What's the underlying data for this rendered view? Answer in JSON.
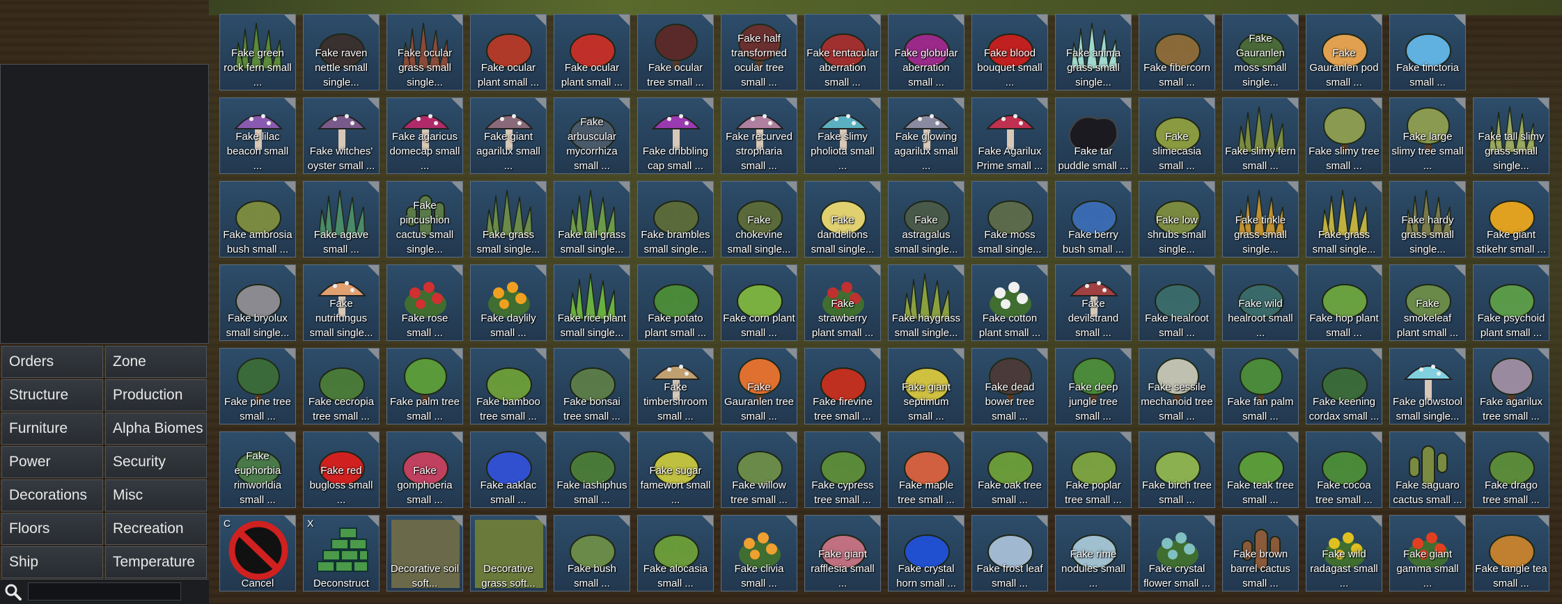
{
  "categories": [
    {
      "label": "Orders",
      "key": "orders"
    },
    {
      "label": "Zone",
      "key": "zone"
    },
    {
      "label": "Structure",
      "key": "structure"
    },
    {
      "label": "Production",
      "key": "production"
    },
    {
      "label": "Furniture",
      "key": "furniture"
    },
    {
      "label": "Alpha Biomes",
      "key": "alpha-biomes"
    },
    {
      "label": "Power",
      "key": "power"
    },
    {
      "label": "Security",
      "key": "security"
    },
    {
      "label": "Decorations",
      "key": "decorations"
    },
    {
      "label": "Misc",
      "key": "misc"
    },
    {
      "label": "Floors",
      "key": "floors"
    },
    {
      "label": "Recreation",
      "key": "recreation"
    },
    {
      "label": "Ship",
      "key": "ship"
    },
    {
      "label": "Temperature",
      "key": "temperature"
    }
  ],
  "search": {
    "value": "",
    "placeholder": ""
  },
  "rows": [
    [
      {
        "label": "Fake green rock fern small ...",
        "icon": "green-fern-icon",
        "color": "#5a8a3a"
      },
      {
        "label": "Fake raven nettle small single...",
        "icon": "raven-nettle-icon",
        "color": "#3a3030"
      },
      {
        "label": "Fake ocular grass small single...",
        "icon": "ocular-grass-icon",
        "color": "#8a4a3a"
      },
      {
        "label": "Fake ocular plant small ...",
        "icon": "ocular-plant-icon",
        "color": "#b03a2a"
      },
      {
        "label": "Fake ocular plant small ...",
        "icon": "ocular-plant-icon",
        "color": "#c0302a"
      },
      {
        "label": "Fake ocular tree small ...",
        "icon": "ocular-tree-icon",
        "color": "#5a2a2a"
      },
      {
        "label": "Fake half transformed ocular tree small ...",
        "icon": "half-ocular-tree-icon",
        "color": "#6a3030"
      },
      {
        "label": "Fake tentacular aberration small ...",
        "icon": "tentacle-icon",
        "color": "#a03030"
      },
      {
        "label": "Fake globular aberration small ...",
        "icon": "globular-icon",
        "color": "#9a2a8a"
      },
      {
        "label": "Fake blood bouquet small ...",
        "icon": "blood-bouquet-icon",
        "color": "#c02020"
      },
      {
        "label": "Fake anima grass small single...",
        "icon": "anima-grass-icon",
        "color": "#a0d8d0"
      },
      {
        "label": "Fake fibercorn small ...",
        "icon": "fibercorn-icon",
        "color": "#8a6a3a"
      },
      {
        "label": "Fake Gauranlen moss small single...",
        "icon": "moss-icon",
        "color": "#4a6a3a"
      },
      {
        "label": "Fake Gauranlen pod small ...",
        "icon": "pod-icon",
        "color": "#e0a050"
      },
      {
        "label": "Fake tinctoria small ...",
        "icon": "tinctoria-icon",
        "color": "#60b0e0"
      }
    ],
    [
      {
        "label": "Fake lilac beacon small ...",
        "icon": "lilac-beacon-icon",
        "color": "#8a5ab0"
      },
      {
        "label": "Fake witches' oyster small ...",
        "icon": "mushroom-icon",
        "color": "#7a5a8a"
      },
      {
        "label": "Fake agaricus domecap small ...",
        "icon": "domecap-icon",
        "color": "#b02a6a"
      },
      {
        "label": "Fake giant agarilux small ...",
        "icon": "agarilux-icon",
        "color": "#8a6a7a"
      },
      {
        "label": "Fake arbuscular mycorrhiza small ...",
        "icon": "mycorrhiza-icon",
        "color": "#4a5a6a"
      },
      {
        "label": "Fake dribbling cap small ...",
        "icon": "dribbling-cap-icon",
        "color": "#9a3ab0"
      },
      {
        "label": "Fake recurved stropharia small ...",
        "icon": "stropharia-icon",
        "color": "#b080a0"
      },
      {
        "label": "Fake slimy pholiota small ...",
        "icon": "pholiota-icon",
        "color": "#5ab0c0"
      },
      {
        "label": "Fake glowing agarilux small ...",
        "icon": "glowing-agarilux-icon",
        "color": "#8a8aa0"
      },
      {
        "label": "Fake Agarilux Prime small ...",
        "icon": "agarilux-prime-icon",
        "color": "#c03050"
      },
      {
        "label": "Fake tar puddle small ...",
        "icon": "tar-puddle-icon",
        "color": "#1a1a20"
      },
      {
        "label": "Fake slimecasia small ...",
        "icon": "slimecasia-icon",
        "color": "#8a9a40"
      },
      {
        "label": "Fake slimy fern small ...",
        "icon": "slimy-fern-icon",
        "color": "#7a8a40"
      },
      {
        "label": "Fake slimy tree small ...",
        "icon": "slimy-tree-icon",
        "color": "#8a9a50"
      },
      {
        "label": "Fake large slimy tree small ...",
        "icon": "large-slimy-tree-icon",
        "color": "#8a9a50"
      },
      {
        "label": "Fake tall slimy grass small single...",
        "icon": "slimy-grass-icon",
        "color": "#9aa860"
      }
    ],
    [
      {
        "label": "Fake ambrosia bush small ...",
        "icon": "ambrosia-icon",
        "color": "#7a8a40"
      },
      {
        "label": "Fake agave small ...",
        "icon": "agave-icon",
        "color": "#4a8a6a"
      },
      {
        "label": "Fake pincushion cactus small single...",
        "icon": "cactus-icon",
        "color": "#5a7a4a"
      },
      {
        "label": "Fake grass small single...",
        "icon": "grass-icon",
        "color": "#6a8a4a"
      },
      {
        "label": "Fake tall grass small single...",
        "icon": "tall-grass-icon",
        "color": "#6a9a4a"
      },
      {
        "label": "Fake brambles small single...",
        "icon": "brambles-icon",
        "color": "#5a6a3a"
      },
      {
        "label": "Fake chokevine small single...",
        "icon": "chokevine-icon",
        "color": "#5a6a3a"
      },
      {
        "label": "Fake dandelions small single...",
        "icon": "dandelion-icon",
        "color": "#e0d070"
      },
      {
        "label": "Fake astragalus small single...",
        "icon": "astragalus-icon",
        "color": "#4a5a4a"
      },
      {
        "label": "Fake moss small single...",
        "icon": "moss-icon",
        "color": "#5a6a4a"
      },
      {
        "label": "Fake berry bush small ...",
        "icon": "berry-bush-icon",
        "color": "#3a6ab0"
      },
      {
        "label": "Fake low shrubs small single...",
        "icon": "shrubs-icon",
        "color": "#7a8a40"
      },
      {
        "label": "Fake tinkle grass small single...",
        "icon": "tinkle-grass-icon",
        "color": "#c09030"
      },
      {
        "label": "Fake grass small single...",
        "icon": "grass-icon",
        "color": "#c0b040"
      },
      {
        "label": "Fake hardy grass small single...",
        "icon": "hardy-grass-icon",
        "color": "#7a7a4a"
      },
      {
        "label": "Fake giant stikehr small ...",
        "icon": "stikehr-icon",
        "color": "#e0a020"
      }
    ],
    [
      {
        "label": "Fake bryolux small single...",
        "icon": "bryolux-icon",
        "color": "#8a8a90"
      },
      {
        "label": "Fake nutrifungus small single...",
        "icon": "nutrifungus-icon",
        "color": "#e0a070"
      },
      {
        "label": "Fake rose small ...",
        "icon": "rose-icon",
        "color": "#d03030"
      },
      {
        "label": "Fake daylily small ...",
        "icon": "daylily-icon",
        "color": "#f0a020"
      },
      {
        "label": "Fake rice plant small single...",
        "icon": "rice-icon",
        "color": "#6ab040"
      },
      {
        "label": "Fake potato plant small ...",
        "icon": "potato-icon",
        "color": "#4a8a3a"
      },
      {
        "label": "Fake corn plant small ...",
        "icon": "corn-icon",
        "color": "#7ab040"
      },
      {
        "label": "Fake strawberry plant small ...",
        "icon": "strawberry-icon",
        "color": "#c03030"
      },
      {
        "label": "Fake haygrass small single...",
        "icon": "haygrass-icon",
        "color": "#8aa040"
      },
      {
        "label": "Fake cotton plant small ...",
        "icon": "cotton-icon",
        "color": "#f0f0f0"
      },
      {
        "label": "Fake devilstrand small ...",
        "icon": "devilstrand-icon",
        "color": "#a04040"
      },
      {
        "label": "Fake healroot small ...",
        "icon": "healroot-icon",
        "color": "#3a6a6a"
      },
      {
        "label": "Fake wild healroot small ...",
        "icon": "wild-healroot-icon",
        "color": "#3a6a6a"
      },
      {
        "label": "Fake hop plant small ...",
        "icon": "hop-icon",
        "color": "#6aa040"
      },
      {
        "label": "Fake smokeleaf plant small ...",
        "icon": "smokeleaf-icon",
        "color": "#6a8a4a"
      },
      {
        "label": "Fake psychoid plant small ...",
        "icon": "psychoid-icon",
        "color": "#5a9a4a"
      }
    ],
    [
      {
        "label": "Fake pine tree small ...",
        "icon": "pine-tree-icon",
        "color": "#3a6a3a"
      },
      {
        "label": "Fake cecropia tree small ...",
        "icon": "cecropia-icon",
        "color": "#4a7a3a"
      },
      {
        "label": "Fake palm tree small ...",
        "icon": "palm-tree-icon",
        "color": "#5a9a3a"
      },
      {
        "label": "Fake bamboo tree small ...",
        "icon": "bamboo-icon",
        "color": "#6a9a3a"
      },
      {
        "label": "Fake bonsai tree small ...",
        "icon": "bonsai-icon",
        "color": "#5a7a4a"
      },
      {
        "label": "Fake timbershroom small ...",
        "icon": "timbershroom-icon",
        "color": "#c0a070"
      },
      {
        "label": "Fake Gauranlen tree small ...",
        "icon": "gauranlen-tree-icon",
        "color": "#e07030"
      },
      {
        "label": "Fake firevine tree small ...",
        "icon": "firevine-icon",
        "color": "#c03020"
      },
      {
        "label": "Fake giant septimum small ...",
        "icon": "septimum-icon",
        "color": "#d0c040"
      },
      {
        "label": "Fake dead bower tree small ...",
        "icon": "dead-tree-icon",
        "color": "#4a3a3a"
      },
      {
        "label": "Fake deep jungle tree small ...",
        "icon": "jungle-tree-icon",
        "color": "#4a8a3a"
      },
      {
        "label": "Fake sessile mechanoid tree small ...",
        "icon": "mechanoid-tree-icon",
        "color": "#c0c0b0"
      },
      {
        "label": "Fake fan palm small ...",
        "icon": "fan-palm-icon",
        "color": "#4a8a3a"
      },
      {
        "label": "Fake keening cordax small ...",
        "icon": "cordax-icon",
        "color": "#3a6a3a"
      },
      {
        "label": "Fake glowstool small single...",
        "icon": "glowstool-icon",
        "color": "#80d0e0"
      },
      {
        "label": "Fake agarilux tree small ...",
        "icon": "agarilux-tree-icon",
        "color": "#9a8aa0"
      }
    ],
    [
      {
        "label": "Fake euphorbia rimworldia small ...",
        "icon": "euphorbia-icon",
        "color": "#4a7a4a"
      },
      {
        "label": "Fake red bugloss small ...",
        "icon": "bugloss-icon",
        "color": "#d02020"
      },
      {
        "label": "Fake gomphoeria small ...",
        "icon": "gomphoeria-icon",
        "color": "#c04060"
      },
      {
        "label": "Fake aaklac small ...",
        "icon": "aaklac-icon",
        "color": "#3050d0"
      },
      {
        "label": "Fake iashiphus small ...",
        "icon": "iashiphus-icon",
        "color": "#4a7a3a"
      },
      {
        "label": "Fake sugar famewort small ...",
        "icon": "famewort-icon",
        "color": "#c0c040"
      },
      {
        "label": "Fake willow tree small ...",
        "icon": "willow-icon",
        "color": "#6a8a4a"
      },
      {
        "label": "Fake cypress tree small ...",
        "icon": "cypress-icon",
        "color": "#5a8a3a"
      },
      {
        "label": "Fake maple tree small ...",
        "icon": "maple-icon",
        "color": "#d06040"
      },
      {
        "label": "Fake oak tree small ...",
        "icon": "oak-icon",
        "color": "#6a9a3a"
      },
      {
        "label": "Fake poplar tree small ...",
        "icon": "poplar-icon",
        "color": "#7aa040"
      },
      {
        "label": "Fake birch tree small ...",
        "icon": "birch-icon",
        "color": "#8ab050"
      },
      {
        "label": "Fake teak tree small ...",
        "icon": "teak-icon",
        "color": "#5a9a3a"
      },
      {
        "label": "Fake cocoa tree small ...",
        "icon": "cocoa-icon",
        "color": "#4a8a3a"
      },
      {
        "label": "Fake saguaro cactus small ...",
        "icon": "saguaro-icon",
        "color": "#7a8a40"
      },
      {
        "label": "Fake drago tree small ...",
        "icon": "drago-icon",
        "color": "#5a8a3a"
      }
    ],
    [
      {
        "label": "Cancel",
        "icon": "cancel-icon",
        "color": "#d02020",
        "hotkey": "C"
      },
      {
        "label": "Deconstruct",
        "icon": "deconstruct-icon",
        "color": "#4a9a4a",
        "hotkey": "X"
      },
      {
        "label": "Decorative soil soft...",
        "icon": "soil-icon",
        "color": "#6a6a4a"
      },
      {
        "label": "Decorative grass soft...",
        "icon": "grass-floor-icon",
        "color": "#6a7a3a"
      },
      {
        "label": "Fake bush small ...",
        "icon": "bush-icon",
        "color": "#6a8a4a"
      },
      {
        "label": "Fake alocasia small ...",
        "icon": "alocasia-icon",
        "color": "#6a9a3a"
      },
      {
        "label": "Fake clivia small ...",
        "icon": "clivia-icon",
        "color": "#f0a030"
      },
      {
        "label": "Fake giant rafflesia small ...",
        "icon": "rafflesia-icon",
        "color": "#c07080"
      },
      {
        "label": "Fake crystal horn small ...",
        "icon": "crystal-horn-icon",
        "color": "#2050d0"
      },
      {
        "label": "Fake frost leaf small ...",
        "icon": "frost-leaf-icon",
        "color": "#a0b8d0"
      },
      {
        "label": "Fake rime nodules small ...",
        "icon": "rime-nodules-icon",
        "color": "#a0c0d0"
      },
      {
        "label": "Fake crystal flower small ...",
        "icon": "crystal-flower-icon",
        "color": "#80c0c0"
      },
      {
        "label": "Fake brown barrel cactus small ...",
        "icon": "barrel-cactus-icon",
        "color": "#8a5a3a"
      },
      {
        "label": "Fake wild radagast small ...",
        "icon": "radagast-icon",
        "color": "#e0c020"
      },
      {
        "label": "Fake giant gamma small ...",
        "icon": "gamma-icon",
        "color": "#e04020"
      },
      {
        "label": "Fake tangle tea small ...",
        "icon": "tangle-tea-icon",
        "color": "#c08030"
      }
    ]
  ]
}
